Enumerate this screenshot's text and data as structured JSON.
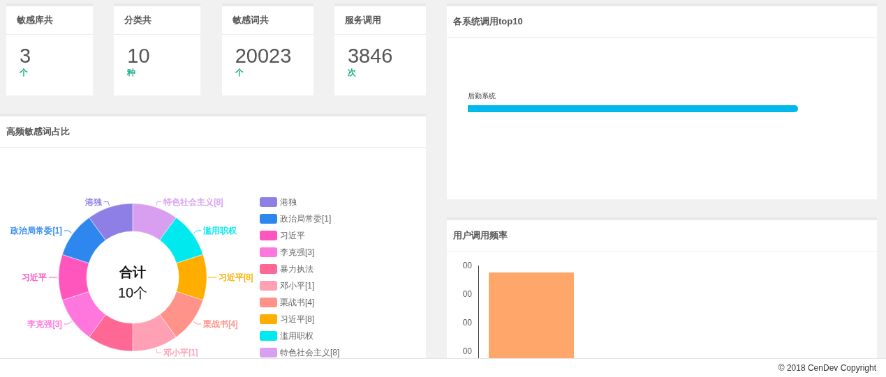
{
  "stats": [
    {
      "title": "敏感库共",
      "value": "3",
      "unit": "个"
    },
    {
      "title": "分类共",
      "value": "10",
      "unit": "种"
    },
    {
      "title": "敏感词共",
      "value": "20023",
      "unit": "个"
    },
    {
      "title": "服务调用",
      "value": "3846",
      "unit": "次"
    }
  ],
  "word_share": {
    "title": "高频敏感词占比",
    "center_title": "合计",
    "center_value": "10个",
    "left_callouts": [
      {
        "text": "港独",
        "color": "#8e7fe6"
      },
      {
        "text": "政治局常委[1]",
        "color": "#2d87ee"
      },
      {
        "text": "习近平",
        "color": "#ff56bd"
      },
      {
        "text": "李克强[3]",
        "color": "#ff76dc"
      }
    ],
    "right_callouts": [
      {
        "text": "特色社会主义[8]",
        "color": "#d89ff0"
      },
      {
        "text": "滥用职权",
        "color": "#00e9ef"
      },
      {
        "text": "习近平[8]",
        "color": "#ffae00"
      },
      {
        "text": "栗战书[4]",
        "color": "#ff9389"
      },
      {
        "text": "邓小平[1]",
        "color": "#ffa0b5"
      }
    ],
    "slices": [
      {
        "name": "港独",
        "color": "#8e7fe6"
      },
      {
        "name": "政治局常委[1]",
        "color": "#2d87ee"
      },
      {
        "name": "习近平",
        "color": "#ff56bd"
      },
      {
        "name": "李克强[3]",
        "color": "#ff76dc"
      },
      {
        "name": "暴力执法",
        "color": "#ff6794"
      },
      {
        "name": "邓小平[1]",
        "color": "#ffa0b5"
      },
      {
        "name": "栗战书[4]",
        "color": "#ff9389"
      },
      {
        "name": "习近平[8]",
        "color": "#ffae00"
      },
      {
        "name": "滥用职权",
        "color": "#00e9ef"
      },
      {
        "name": "特色社会主义[8]",
        "color": "#d89ff0"
      }
    ]
  },
  "top10": {
    "title": "各系统调用top10",
    "rows": [
      {
        "name": "后勤系统"
      }
    ]
  },
  "frequency": {
    "title": "用户调用频率",
    "ticks": [
      "00",
      "00",
      "00",
      "00"
    ]
  },
  "footer": "© 2018 CenDev Copyright"
}
